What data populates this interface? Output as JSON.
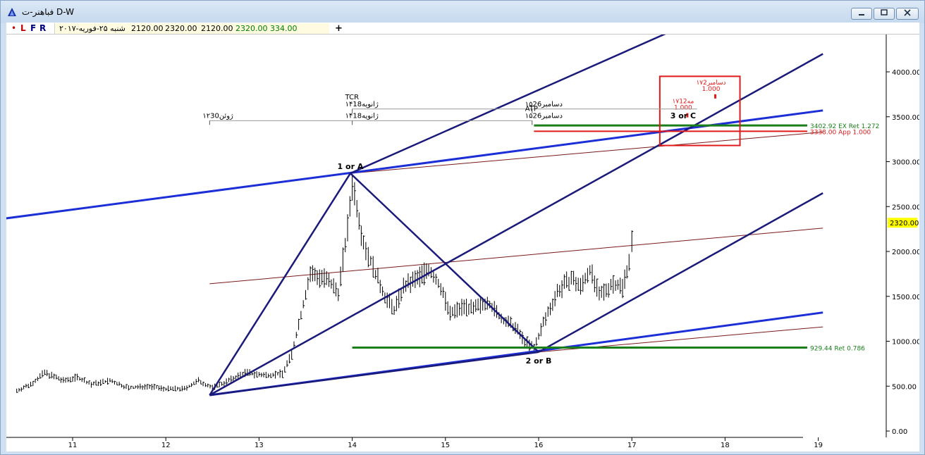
{
  "window": {
    "title": "فباهنر-ت D-W",
    "minimize_icon": "minimize-icon",
    "maximize_icon": "maximize-icon",
    "close_icon": "close-icon"
  },
  "infobar": {
    "dot": "•",
    "letters": [
      "L",
      "F",
      "R"
    ],
    "date": "شنبه ۲۵-فوریه-۲۰۱۷",
    "open": "2120.00",
    "high": "2320.00",
    "low": "2120.00",
    "close": "2320.00",
    "volume": "334.00",
    "add_label": "+"
  },
  "colors": {
    "fork": "#1a1a7a",
    "median": "#1c2fd6",
    "green": "#1a7f1a",
    "red": "#e01a1a",
    "thin": "#7a1a1a",
    "price_tag": "#ffff00"
  },
  "chart_data": {
    "type": "bar",
    "xlabel": "",
    "ylabel": "",
    "x_ticks": [
      "11",
      "12",
      "13",
      "14",
      "15",
      "16",
      "17",
      "18",
      "19"
    ],
    "y_ticks": [
      "0.00",
      "500.00",
      "1000.00",
      "1500.00",
      "2000.00",
      "2500.00",
      "3000.00",
      "3500.00",
      "4000.00"
    ],
    "ylim": [
      -50,
      4400
    ],
    "last_price": "2320.00",
    "price_path": [
      [
        10.4,
        450
      ],
      [
        10.55,
        520
      ],
      [
        10.7,
        650
      ],
      [
        10.9,
        560
      ],
      [
        11.05,
        600
      ],
      [
        11.2,
        520
      ],
      [
        11.4,
        560
      ],
      [
        11.6,
        480
      ],
      [
        11.8,
        500
      ],
      [
        12.0,
        470
      ],
      [
        12.2,
        470
      ],
      [
        12.35,
        560
      ],
      [
        12.5,
        480
      ],
      [
        12.65,
        550
      ],
      [
        12.85,
        650
      ],
      [
        13.05,
        620
      ],
      [
        13.25,
        640
      ],
      [
        13.35,
        850
      ],
      [
        13.45,
        1300
      ],
      [
        13.55,
        1750
      ],
      [
        13.7,
        1700
      ],
      [
        13.85,
        1550
      ],
      [
        13.95,
        2250
      ],
      [
        14.0,
        2750
      ],
      [
        14.05,
        2500
      ],
      [
        14.12,
        2100
      ],
      [
        14.25,
        1750
      ],
      [
        14.35,
        1500
      ],
      [
        14.45,
        1350
      ],
      [
        14.55,
        1600
      ],
      [
        14.7,
        1700
      ],
      [
        14.82,
        1800
      ],
      [
        14.95,
        1600
      ],
      [
        15.05,
        1300
      ],
      [
        15.2,
        1400
      ],
      [
        15.3,
        1350
      ],
      [
        15.45,
        1450
      ],
      [
        15.6,
        1250
      ],
      [
        15.75,
        1150
      ],
      [
        15.85,
        1000
      ],
      [
        15.95,
        920
      ],
      [
        16.05,
        1200
      ],
      [
        16.2,
        1550
      ],
      [
        16.35,
        1700
      ],
      [
        16.45,
        1600
      ],
      [
        16.55,
        1800
      ],
      [
        16.65,
        1500
      ],
      [
        16.8,
        1650
      ],
      [
        16.9,
        1600
      ],
      [
        16.97,
        1900
      ],
      [
        17.03,
        2300
      ]
    ],
    "fork_lines": [
      {
        "x1": 12.47,
        "y1": 400,
        "x2": 16.0,
        "y2": 880,
        "role": "base"
      },
      {
        "x1": 12.47,
        "y1": 400,
        "x2": 13.98,
        "y2": 2870,
        "role": "swing-a"
      },
      {
        "x1": 13.98,
        "y1": 2870,
        "x2": 16.0,
        "y2": 880,
        "role": "swing-b"
      },
      {
        "x1": 13.98,
        "y1": 2870,
        "x2": 17.7,
        "y2": 4580,
        "role": "upper-tine"
      },
      {
        "x1": 12.47,
        "y1": 400,
        "x2": 19.05,
        "y2": 4200,
        "role": "median"
      },
      {
        "x1": 16.0,
        "y1": 880,
        "x2": 19.05,
        "y2": 2650,
        "role": "lower-tine"
      }
    ],
    "median_lines": [
      {
        "x1": 10.15,
        "y1": 2350,
        "x2": 19.05,
        "y2": 3570
      },
      {
        "x1": 12.47,
        "y1": 400,
        "x2": 19.05,
        "y2": 1320
      }
    ],
    "thin_lines": [
      {
        "x1": 13.98,
        "y1": 2870,
        "x2": 19.05,
        "y2": 3330
      },
      {
        "x1": 12.47,
        "y1": 1640,
        "x2": 19.05,
        "y2": 2260
      },
      {
        "x1": 16.0,
        "y1": 880,
        "x2": 19.05,
        "y2": 1160
      }
    ],
    "levels": [
      {
        "label": "3402.92 EX Ret 1.272",
        "value": 3402.92,
        "x_start": 15.95,
        "color": "green"
      },
      {
        "label": "3338.00 App 1.000",
        "value": 3338.0,
        "x_start": 15.95,
        "color": "red"
      },
      {
        "label": "929.44 Ret 0.786",
        "value": 929.44,
        "x_start": 14.0,
        "color": "green"
      }
    ],
    "point_labels": [
      {
        "text": "1 or A",
        "x": 13.98,
        "y": 2870,
        "pos": "above"
      },
      {
        "text": "2 or B",
        "x": 16.0,
        "y": 880,
        "pos": "below"
      },
      {
        "text": "3 or C",
        "x": 17.55,
        "y": 3435,
        "pos": "above"
      }
    ],
    "time_markers": [
      {
        "label": "TCR",
        "sub": "۱۴ژانویه18",
        "x": 14.0,
        "y": 3680,
        "line_to": 17.7
      },
      {
        "label": "",
        "sub": "۱۵دسامبر26",
        "x": 15.93,
        "y": 3680,
        "line_to": null
      },
      {
        "label": "",
        "sub": "۱۲ژوئن30",
        "x": 12.47,
        "y": 3550,
        "line_to": 15.93
      },
      {
        "label": "",
        "sub": "۱۴ژانویه18",
        "x": 14.0,
        "y": 3550,
        "line_to": null
      },
      {
        "label": "ATP",
        "sub": "۱۵دسامبر26",
        "x": 15.93,
        "y": 3550,
        "line_to": null
      }
    ],
    "target_box": {
      "x1": 17.3,
      "y1": 3950,
      "x2": 18.16,
      "y2": 3180,
      "notes": [
        {
          "line1": "۱۷دسامبر2",
          "line2": "1.000",
          "x": 17.85,
          "y": 3860
        },
        {
          "line1": "۱۷مه12",
          "line2": "1.000",
          "x": 17.55,
          "y": 3650
        }
      ]
    }
  }
}
